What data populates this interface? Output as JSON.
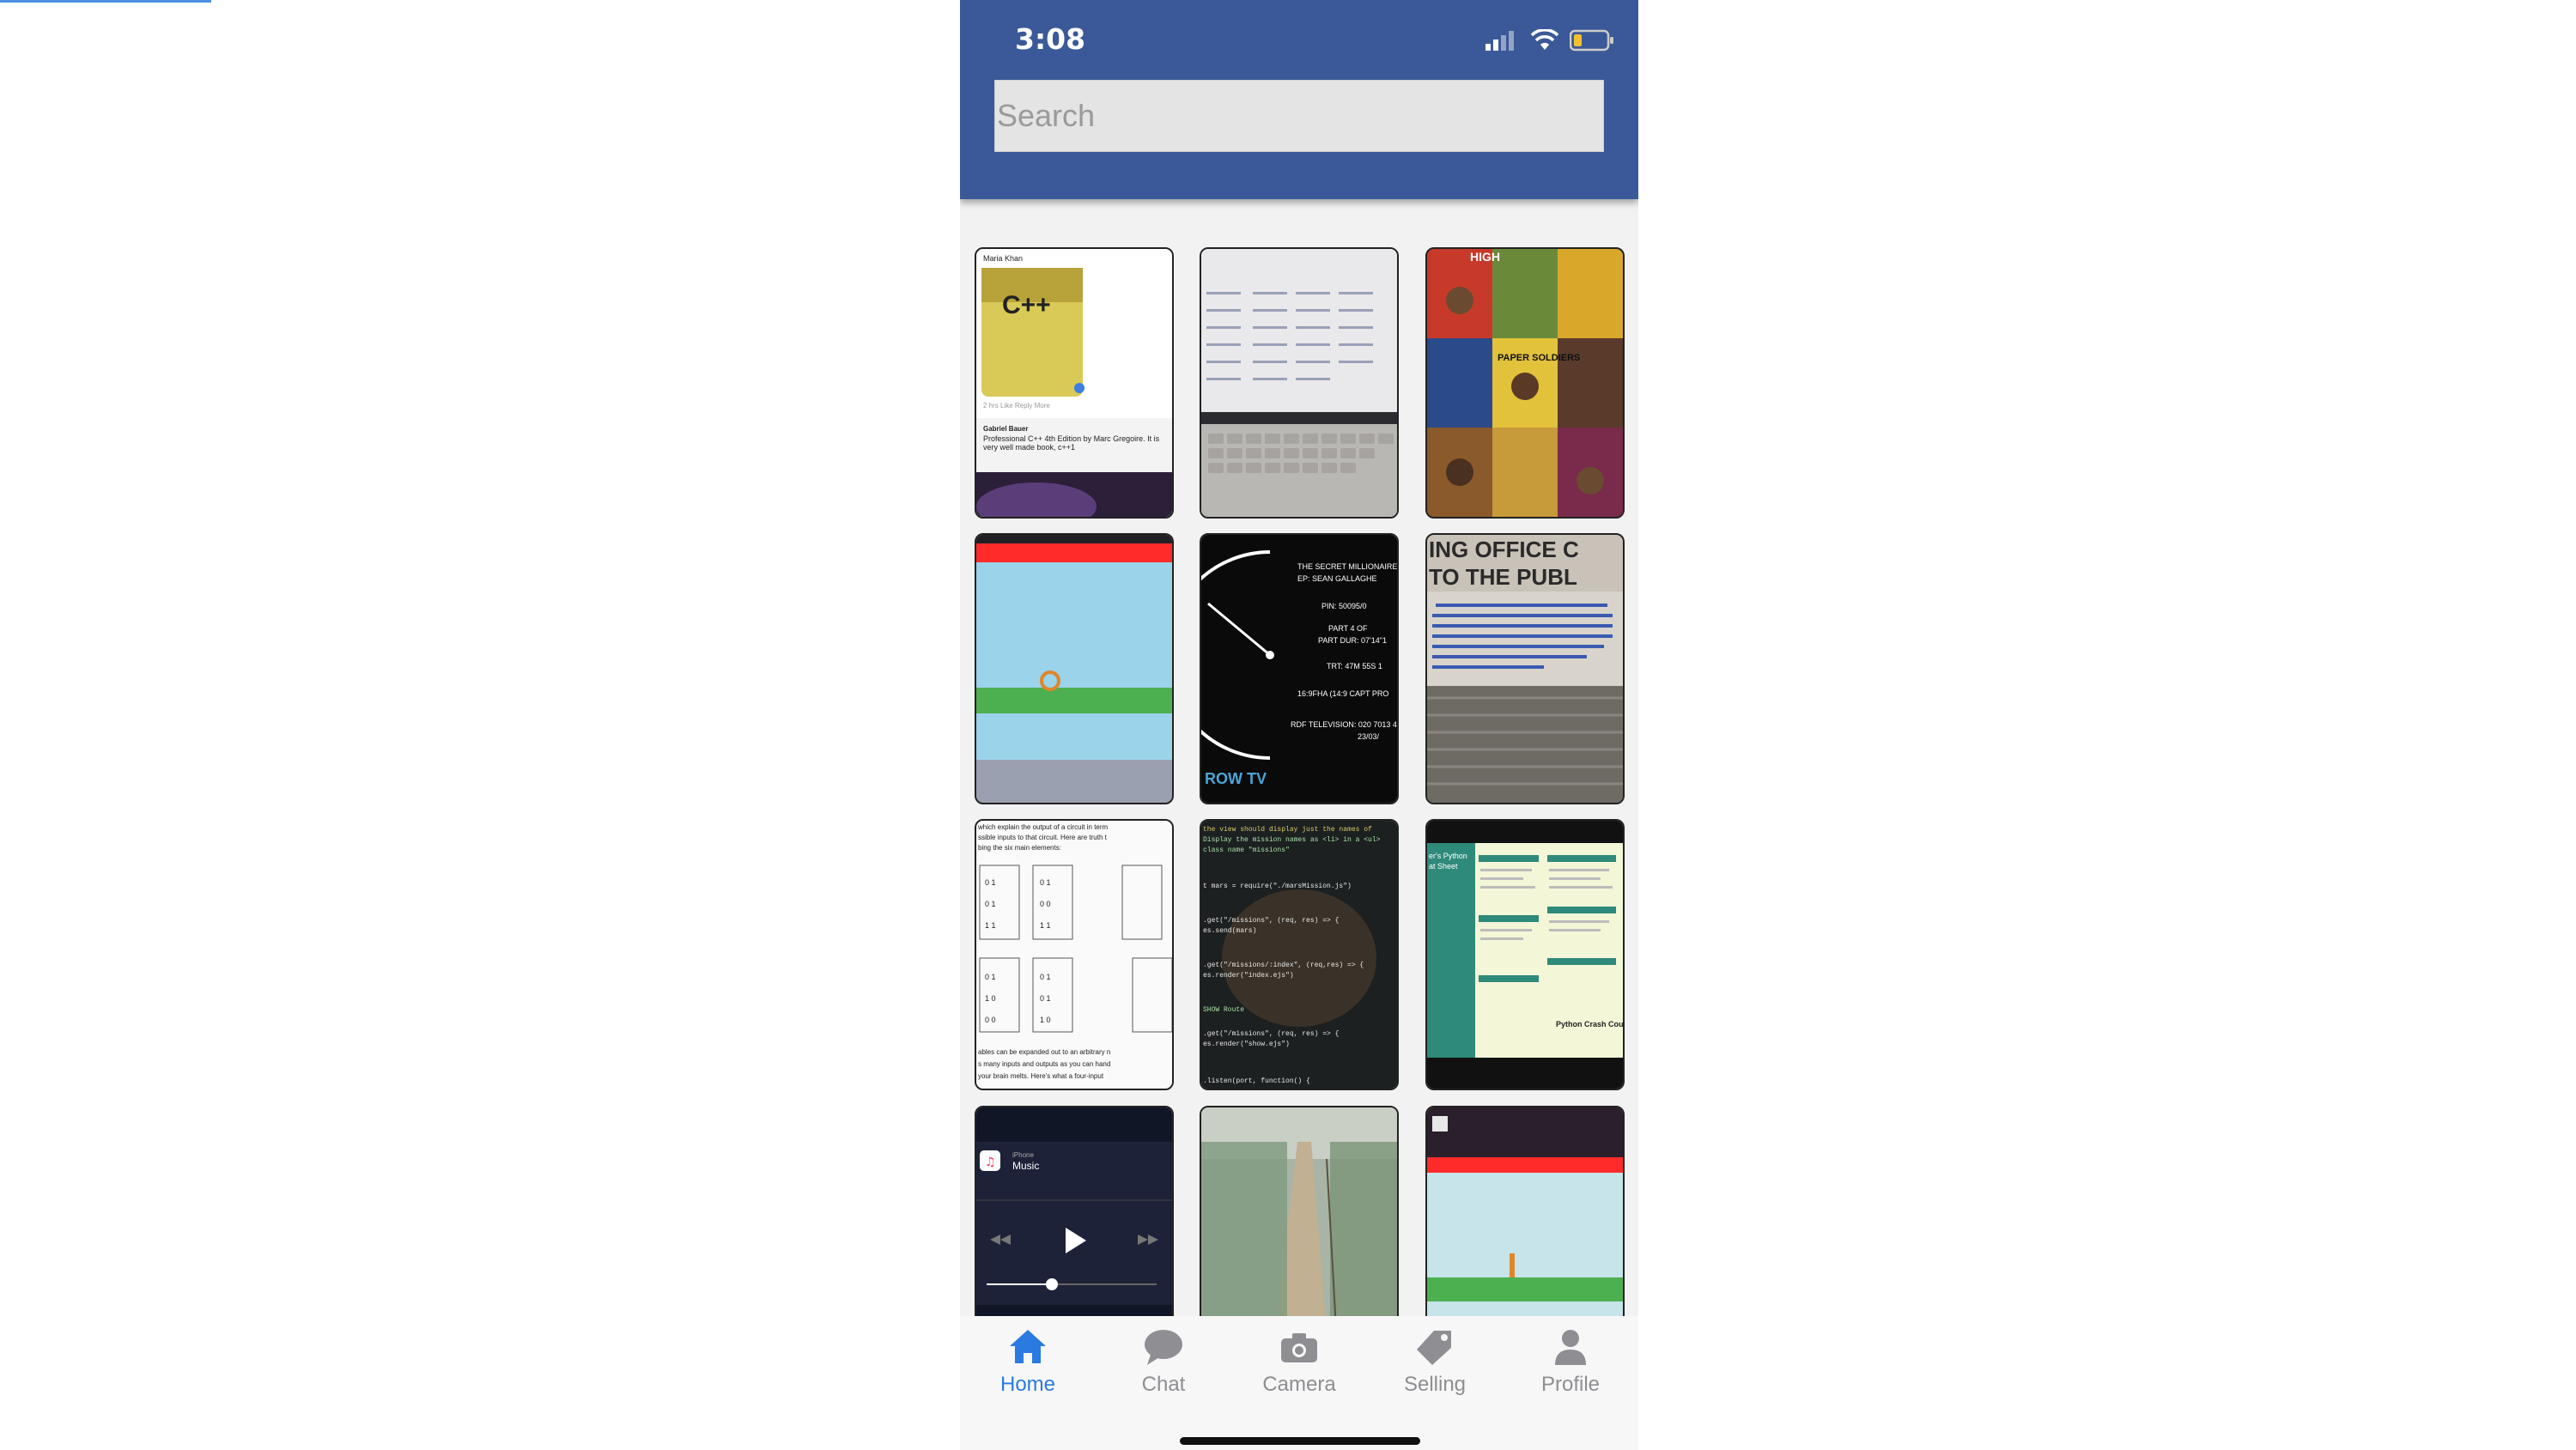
{
  "status_bar": {
    "time": "3:08"
  },
  "search": {
    "placeholder": "Search"
  },
  "gallery": {
    "items": [
      {
        "kind": "comment-screenshot",
        "name": "Maria Khan",
        "meta": "2 hrs  Like  Reply  More",
        "author": "Gabriel Bauer",
        "text": "Professional C++ 4th Edition by Marc Gregoire. It is very well made book, c++1",
        "badge": "C++"
      },
      {
        "kind": "laptop-screen"
      },
      {
        "kind": "movie-posters",
        "text1": "HIGH",
        "text2": "PAPER SOLDIERS"
      },
      {
        "kind": "game-scene"
      },
      {
        "kind": "film-leader",
        "l1": "THE SECRET MILLIONAIRE",
        "l2": "EP: SEAN GALLAGHE",
        "l3": "PIN: 50095/0",
        "l4": "PART 4 OF",
        "l5": "PART DUR: 07'14\"1",
        "l6": "TRT: 47M 55S 1",
        "l7": "16:9FHA (14:9 CAPT PRO",
        "l8": "RDF TELEVISION: 020 7013 40",
        "l9": "23/03/",
        "l10": "ROW TV"
      },
      {
        "kind": "notice-sign",
        "l1": "ING OFFICE C",
        "l2": "TO THE PUBL"
      },
      {
        "kind": "truth-tables",
        "top1": "which explain the output of a circuit in term",
        "top2": "ssible inputs to that circuit. Here are truth t",
        "top3": "bing the six main elements:",
        "b1": "ables can be expanded out to an arbitrary n",
        "b2": "s many inputs and outputs as you can hand",
        "b3": "your brain melts. Here's what a four-input"
      },
      {
        "kind": "code-photo",
        "l1": "the view should display just the names of",
        "l2": "Display the mission names as <li> in a <ul>",
        "l3": "class name \"missions\"",
        "l4": "t mars = require(\"./marsMission.js\")",
        "l5": ".get(\"/missions\", (req, res) => {",
        "l6": "es.send(mars)",
        "l7": ".get(\"/missions/:index\", (req,res) => {",
        "l8": "es.render(\"index.ejs\")",
        "l9": "SHOW Route",
        "l10": ".get(\"/missions\", (req, res) => {",
        "l11": "es.render(\"show.ejs\")",
        "l12": ".listen(port, function() {"
      },
      {
        "kind": "cheat-sheet",
        "title": "er's Python",
        "sub": "at Sheet",
        "foot": "Python Crash Cou"
      },
      {
        "kind": "music-widget",
        "source": "iPhone",
        "title": "Music"
      },
      {
        "kind": "forest-path"
      },
      {
        "kind": "game-scene-2"
      }
    ]
  },
  "tabs": [
    {
      "label": "Home",
      "icon": "home-icon",
      "active": true
    },
    {
      "label": "Chat",
      "icon": "chat-icon",
      "active": false
    },
    {
      "label": "Camera",
      "icon": "camera-icon",
      "active": false
    },
    {
      "label": "Selling",
      "icon": "tag-icon",
      "active": false
    },
    {
      "label": "Profile",
      "icon": "profile-icon",
      "active": false
    }
  ],
  "colors": {
    "header": "#3b5998",
    "active_tab": "#2a7ae2",
    "inactive_tab": "#8e8e93"
  }
}
